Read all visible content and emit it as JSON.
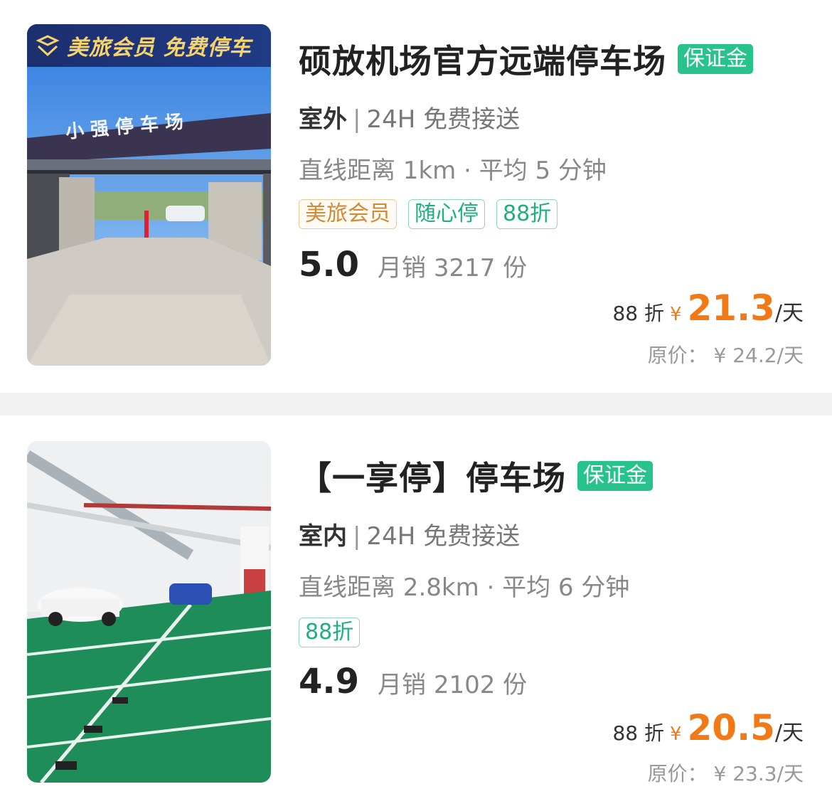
{
  "listings": [
    {
      "photo_banner_text": "美旅会员 免费停车",
      "title": "硕放机场官方远端停车场",
      "deposit_badge": "保证金",
      "kind": "室外",
      "separator": "|",
      "service": "24H 免费接送",
      "distance": "直线距离 1km · 平均 5 分钟",
      "tags": [
        "美旅会员",
        "随心停",
        "88折"
      ],
      "rating": "5.0",
      "sales": "月销 3217 份",
      "discount_label": "88 折",
      "currency": "¥",
      "price": "21.3",
      "unit": "/天",
      "original_price": "原价： ¥ 24.2/天"
    },
    {
      "title": "【一享停】停车场",
      "deposit_badge": "保证金",
      "kind": "室内",
      "separator": "|",
      "service": "24H 免费接送",
      "distance": "直线距离 2.8km · 平均 6 分钟",
      "tags": [
        "88折"
      ],
      "rating": "4.9",
      "sales": "月销 2102 份",
      "discount_label": "88 折",
      "currency": "¥",
      "price": "20.5",
      "unit": "/天",
      "original_price": "原价： ¥ 23.3/天"
    }
  ],
  "colors": {
    "accent_green": "#27c38a",
    "price_orange": "#f27a16",
    "member_tag": "#d08a3b"
  }
}
